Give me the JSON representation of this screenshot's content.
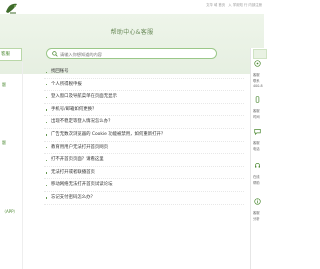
{
  "header": {
    "logo_icon": "logo-icon",
    "links": [
      "文华 域 首页",
      "入 学用知 行 内部注册"
    ]
  },
  "page_title": "帮助中心&客服",
  "sidebar": {
    "heading": "客服",
    "items": [
      {
        "label": "题"
      },
      {
        "label": "题"
      },
      {
        "label": "（APP）"
      }
    ]
  },
  "search": {
    "placeholder": "请输入你想知道的内容",
    "icon": "search-icon"
  },
  "faq": [
    "找回账号",
    "个人所得税申报",
    "登入窗口及导航菜单在页面无显示",
    "手机号/邮箱如何更换？",
    "出现不稳定等登入情况怎么办？",
    "广告无数次浏览器的 Cookie 功能被禁用，如何重新打开？",
    "教育用用户无法打开首页网页",
    "打不开首页页面？请看这里",
    "无法打开或者联播首页",
    "移动网络无法打开首页试读论坛",
    "忘记支付密码怎么办？"
  ],
  "right_panel": {
    "lines": [
      "客服",
      "联系",
      "400-8",
      "",
      "客服",
      "",
      "时间",
      "",
      "客服",
      "",
      "电话",
      "",
      "在线",
      "帮助",
      "",
      "客服",
      "分析"
    ]
  },
  "colors": {
    "brand_green": "#4e8a34",
    "banner_bg": "#eef5ea",
    "search_border": "#9bc889"
  }
}
